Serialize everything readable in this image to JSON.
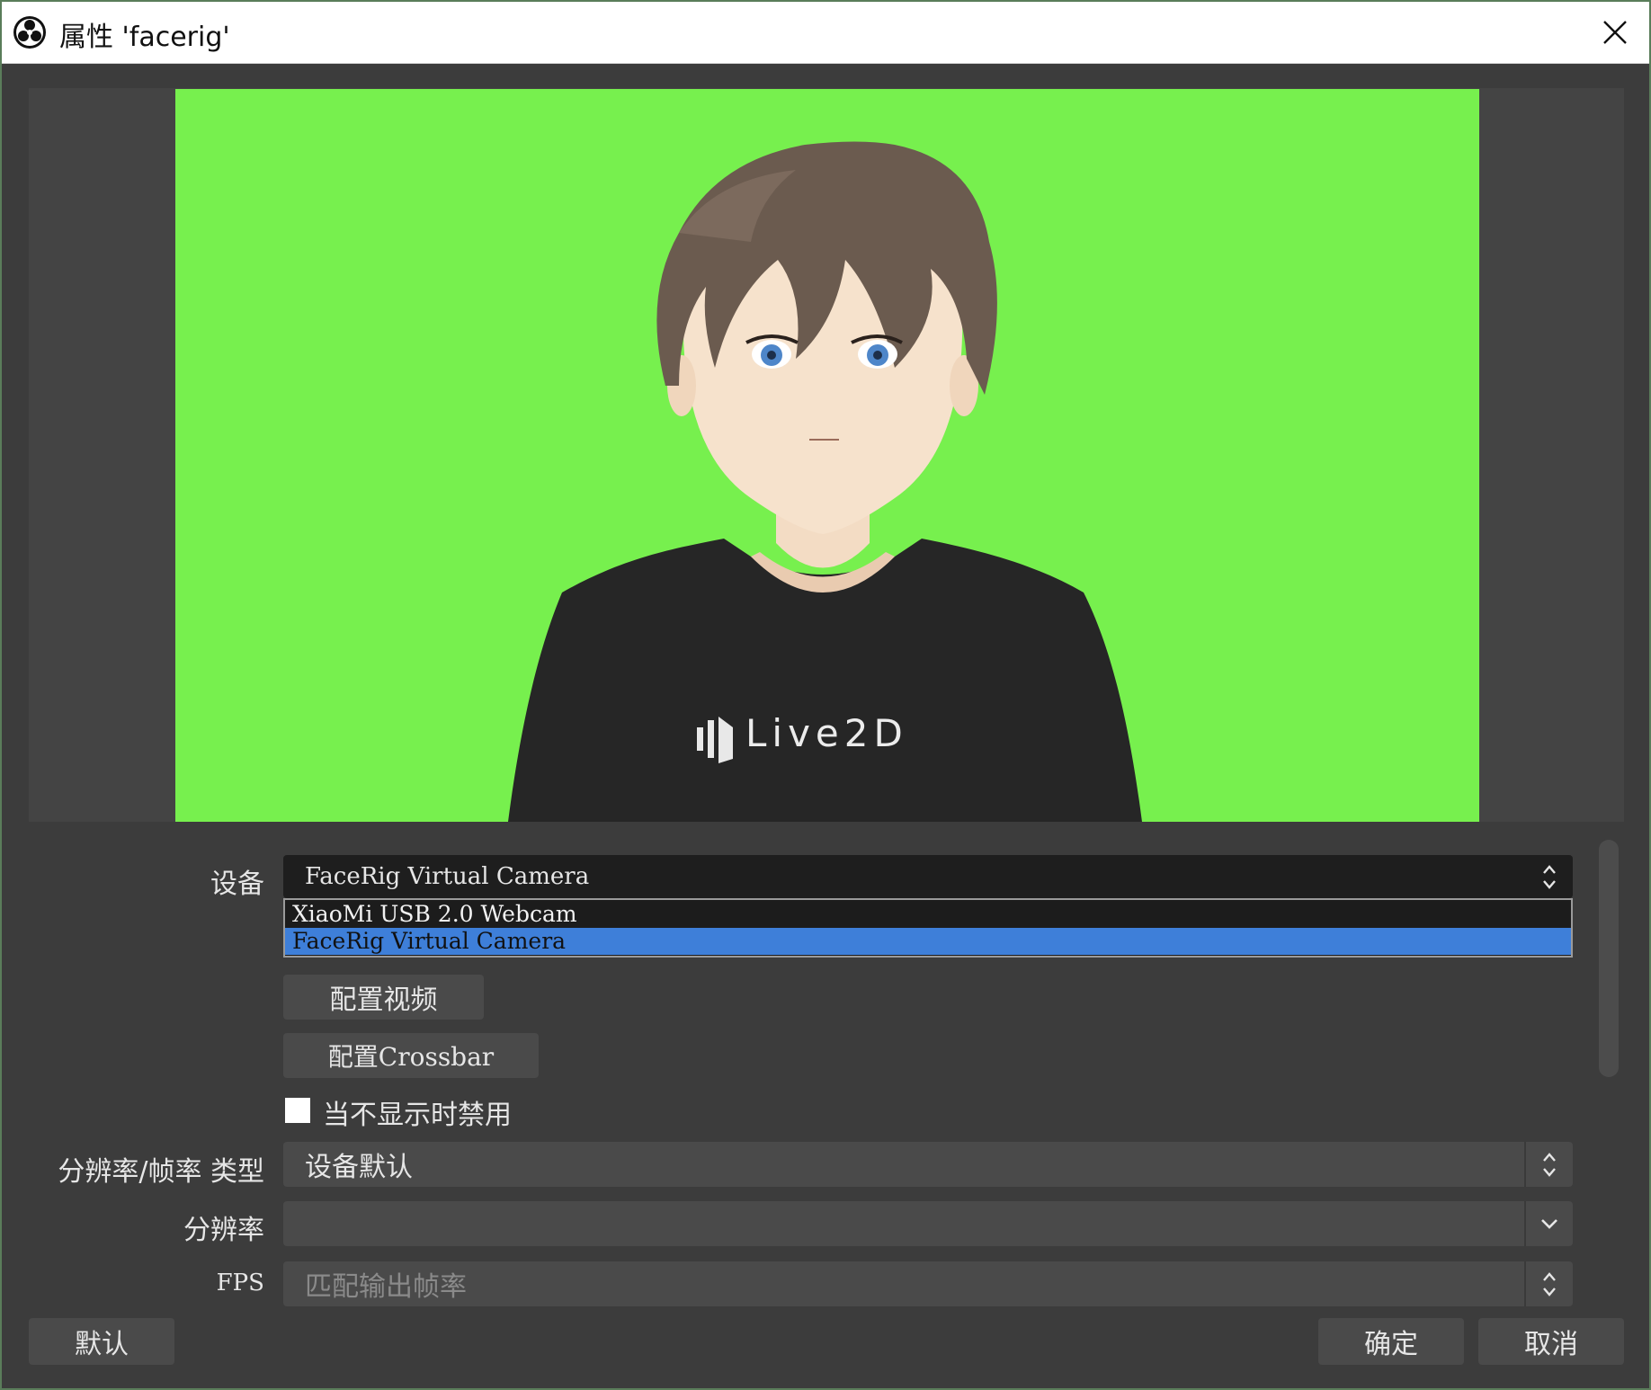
{
  "window": {
    "title": "属性 'facerig'",
    "title_icon": "obs-logo-icon",
    "close_icon": "close-icon"
  },
  "preview": {
    "background_color": "#77f04e",
    "shirt_logo_text": "Live2D"
  },
  "form": {
    "device": {
      "label": "设备",
      "value": "FaceRig Virtual Camera",
      "options": [
        "XiaoMi USB 2.0 Webcam",
        "FaceRig Virtual Camera"
      ],
      "selected_index": 1
    },
    "configure_video_label": "配置视频",
    "configure_crossbar_label": "配置Crossbar",
    "deactivate_when_hidden": {
      "label": "当不显示时禁用",
      "checked": false
    },
    "resolution_type": {
      "label": "分辨率/帧率 类型",
      "value": "设备默认"
    },
    "resolution": {
      "label": "分辨率",
      "value": ""
    },
    "fps": {
      "label": "FPS",
      "value": "匹配输出帧率"
    }
  },
  "footer": {
    "defaults_label": "默认",
    "ok_label": "确定",
    "cancel_label": "取消"
  },
  "colors": {
    "window_bg": "#3c3c3c",
    "control_bg": "#4a4a4a",
    "selection": "#3e7fd9",
    "chroma_green": "#77f04e"
  }
}
